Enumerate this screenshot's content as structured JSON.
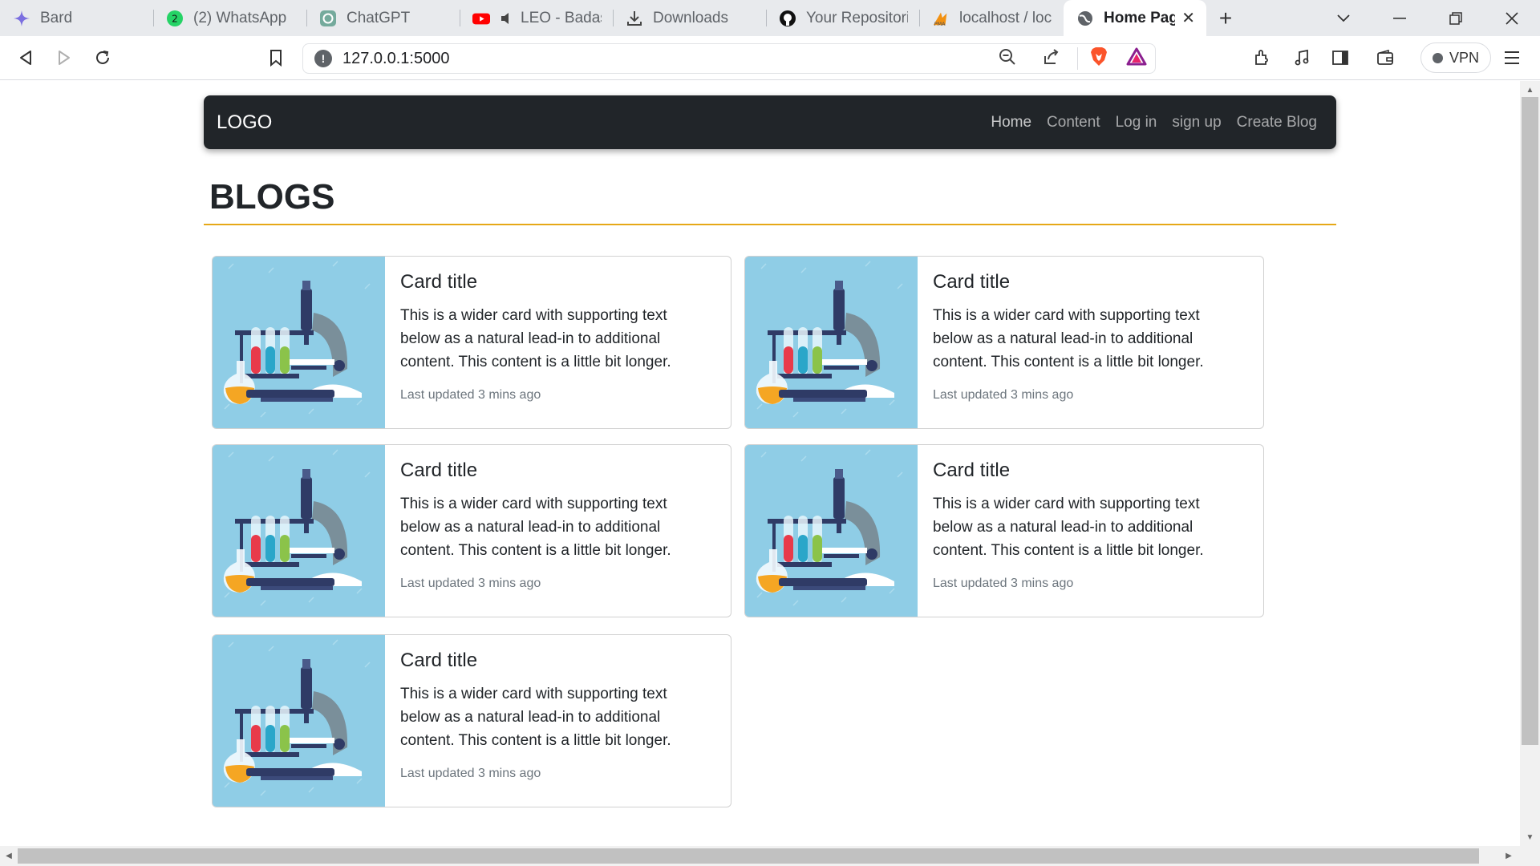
{
  "browser": {
    "tabs": [
      {
        "label": "Bard",
        "icon": "bard-icon"
      },
      {
        "label": "(2) WhatsApp",
        "icon": "whatsapp-icon",
        "badge": "2"
      },
      {
        "label": "ChatGPT",
        "icon": "chatgpt-icon"
      },
      {
        "label": "LEO - Badass",
        "icon": "youtube-icon"
      },
      {
        "label": "Downloads",
        "icon": "download-icon"
      },
      {
        "label": "Your Repositories",
        "icon": "github-icon"
      },
      {
        "label": "localhost / localhost",
        "icon": "phpmyadmin-icon"
      }
    ],
    "active_tab": {
      "label": "Home Page",
      "icon": "globe-icon"
    },
    "url": "127.0.0.1:5000",
    "vpn_label": "VPN"
  },
  "site": {
    "brand": "LOGO",
    "nav": [
      {
        "label": "Home"
      },
      {
        "label": "Content"
      },
      {
        "label": "Log in"
      },
      {
        "label": "sign up"
      },
      {
        "label": "Create Blog"
      }
    ],
    "page_title": "BLOGS",
    "accent_color": "#e6a817",
    "navbar_color": "#212529"
  },
  "cards": [
    {
      "title": "Card title",
      "text": "This is a wider card with supporting text below as a natural lead-in to additional content. This content is a little bit longer.",
      "meta": "Last updated 3 mins ago"
    },
    {
      "title": "Card title",
      "text": "This is a wider card with supporting text below as a natural lead-in to additional content. This content is a little bit longer.",
      "meta": "Last updated 3 mins ago"
    },
    {
      "title": "Card title",
      "text": "This is a wider card with supporting text below as a natural lead-in to additional content. This content is a little bit longer.",
      "meta": "Last updated 3 mins ago"
    },
    {
      "title": "Card title",
      "text": "This is a wider card with supporting text below as a natural lead-in to additional content. This content is a little bit longer.",
      "meta": "Last updated 3 mins ago"
    },
    {
      "title": "Card title",
      "text": "This is a wider card with supporting text below as a natural lead-in to additional content. This content is a little bit longer.",
      "meta": "Last updated 3 mins ago"
    }
  ]
}
